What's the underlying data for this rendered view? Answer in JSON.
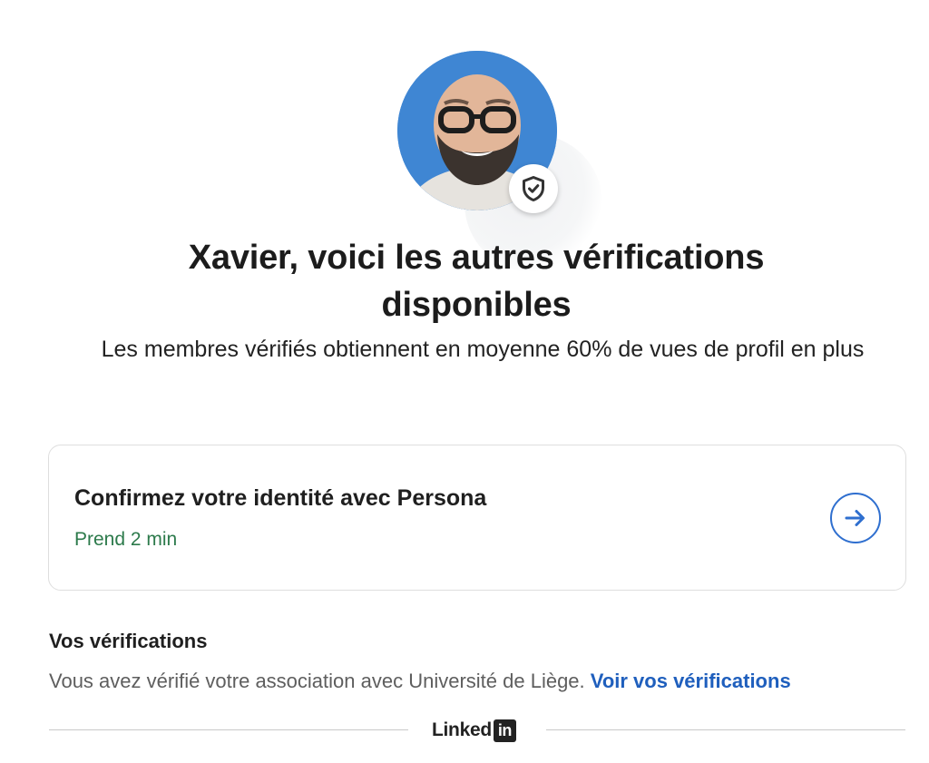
{
  "profile": {
    "avatar_alt": "Xavier",
    "badge_icon": "verified-shield-icon"
  },
  "headline": {
    "title": "Xavier, voici les autres vérifications disponibles",
    "subtitle": "Les membres vérifiés obtiennent en moyenne 60% de vues de profil en plus"
  },
  "card": {
    "title": "Confirmez votre identité avec Persona",
    "duration": "Prend 2 min",
    "arrow_icon": "arrow-right-icon",
    "duration_color": "#2c7a4b",
    "accent_color": "#2f6fcf"
  },
  "verifications": {
    "title": "Vos vérifications",
    "text": "Vous avez vérifié votre association avec Université de Liège.",
    "link": "Voir vos vérifications",
    "link_color": "#1f5fbd"
  },
  "footer": {
    "brand_text": "Linked",
    "brand_badge": "in"
  }
}
